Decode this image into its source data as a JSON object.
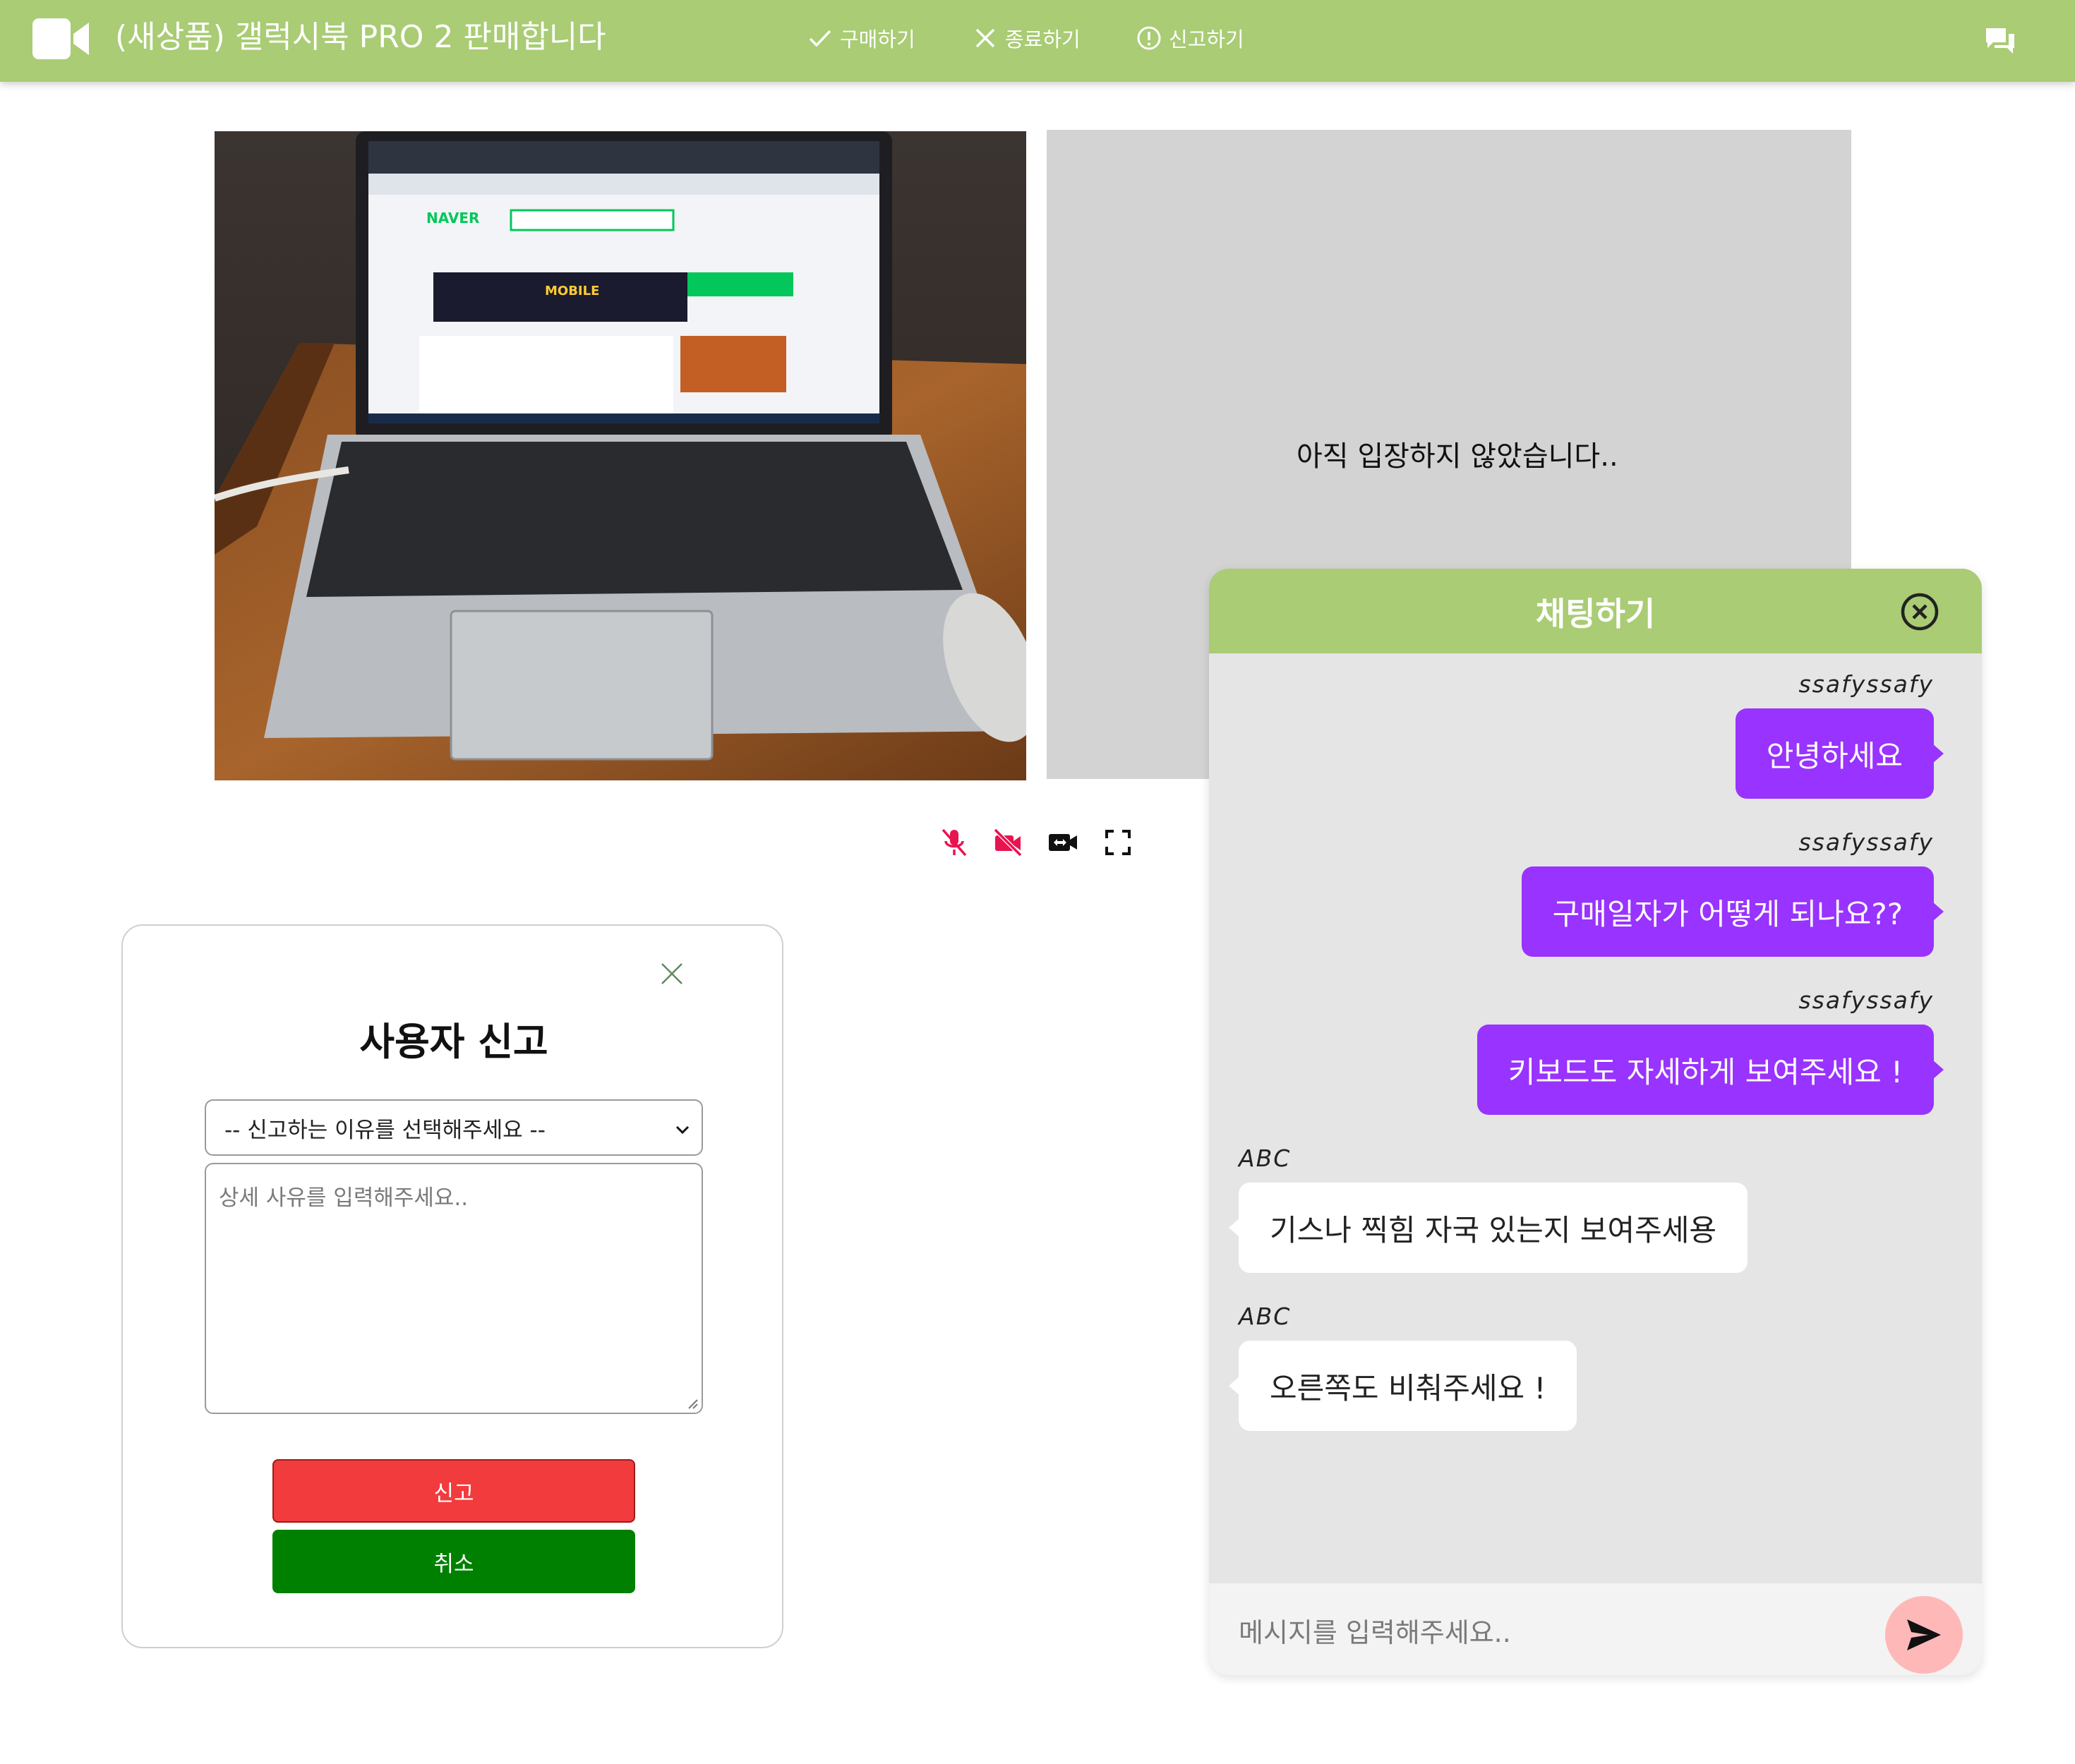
{
  "header": {
    "title": "(새상품) 갤럭시북 PRO 2 판매합니다",
    "actions": {
      "buy": "구매하기",
      "end": "종료하기",
      "report": "신고하기"
    },
    "icons": {
      "brand": "video-camera-icon",
      "buy": "check-icon",
      "end": "close-icon",
      "report": "alert-circle-icon",
      "chat": "chat-bubbles-icon"
    },
    "accent_color": "#a9cc74"
  },
  "remote_video": {
    "status_text": "아직 입장하지 않았습니다.."
  },
  "local_video": {
    "description": ""
  },
  "media_controls": [
    "mic-off-icon",
    "camera-off-icon",
    "switch-camera-icon",
    "fullscreen-icon"
  ],
  "report_modal": {
    "title": "사용자 신고",
    "reason_select": "-- 신고하는 이유를 선택해주세요 --",
    "detail_placeholder": "상세 사유를 입력해주세요..",
    "submit_label": "신고",
    "cancel_label": "취소"
  },
  "chat": {
    "title": "채팅하기",
    "messages": [
      {
        "sender": "ssafyssafy",
        "text": "안녕하세요",
        "mine": true
      },
      {
        "sender": "ssafyssafy",
        "text": "구매일자가 어떻게 되나요??",
        "mine": true
      },
      {
        "sender": "ssafyssafy",
        "text": "키보드도 자세하게 보여주세요 !",
        "mine": true
      },
      {
        "sender": "ABC",
        "text": "기스나 찍힘 자국 있는지 보여주세용",
        "mine": false
      },
      {
        "sender": "ABC",
        "text": "오른쪽도 비춰주세요 !",
        "mine": false
      }
    ],
    "input_placeholder": "메시지를 입력해주세요..",
    "mine_color": "#9933ff",
    "send_button_color": "#ffb8b8"
  }
}
